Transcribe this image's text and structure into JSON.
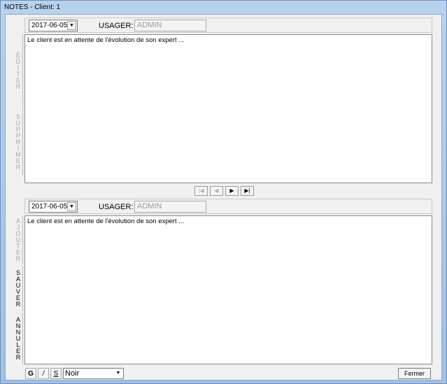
{
  "window": {
    "title": "NOTES - Client: 1"
  },
  "top": {
    "date": "2017-06-05",
    "usager_label": "USAGER:",
    "usager_value": "ADMIN",
    "note_text": "Le client est en attente de l'évolution de son expert ..."
  },
  "side_top": {
    "editer": [
      "É",
      "D",
      "I",
      "T",
      "E",
      "R"
    ],
    "supprimer": [
      "S",
      "U",
      "P",
      "P",
      "R",
      "I",
      "M",
      "E",
      "R"
    ]
  },
  "nav": {
    "first": "first-record-icon",
    "prev": "prev-record-icon",
    "next": "next-record-icon",
    "last": "last-record-icon"
  },
  "bottom": {
    "date": "2017-06-05",
    "usager_label": "USAGER:",
    "usager_value": "ADMIN",
    "note_text": "Le client est en attente de l'évolution de son expert ..."
  },
  "side_bottom": {
    "ajouter": [
      "A",
      "J",
      "O",
      "U",
      "T",
      "E",
      "R"
    ],
    "sauver": [
      "S",
      "A",
      "U",
      "V",
      "E",
      "R"
    ],
    "annuler": [
      "A",
      "N",
      "N",
      "U",
      "L",
      "E",
      "R"
    ]
  },
  "format": {
    "bold": "G",
    "italic": "/",
    "underline": "S",
    "color": "Noir"
  },
  "close_label": "Fermer"
}
